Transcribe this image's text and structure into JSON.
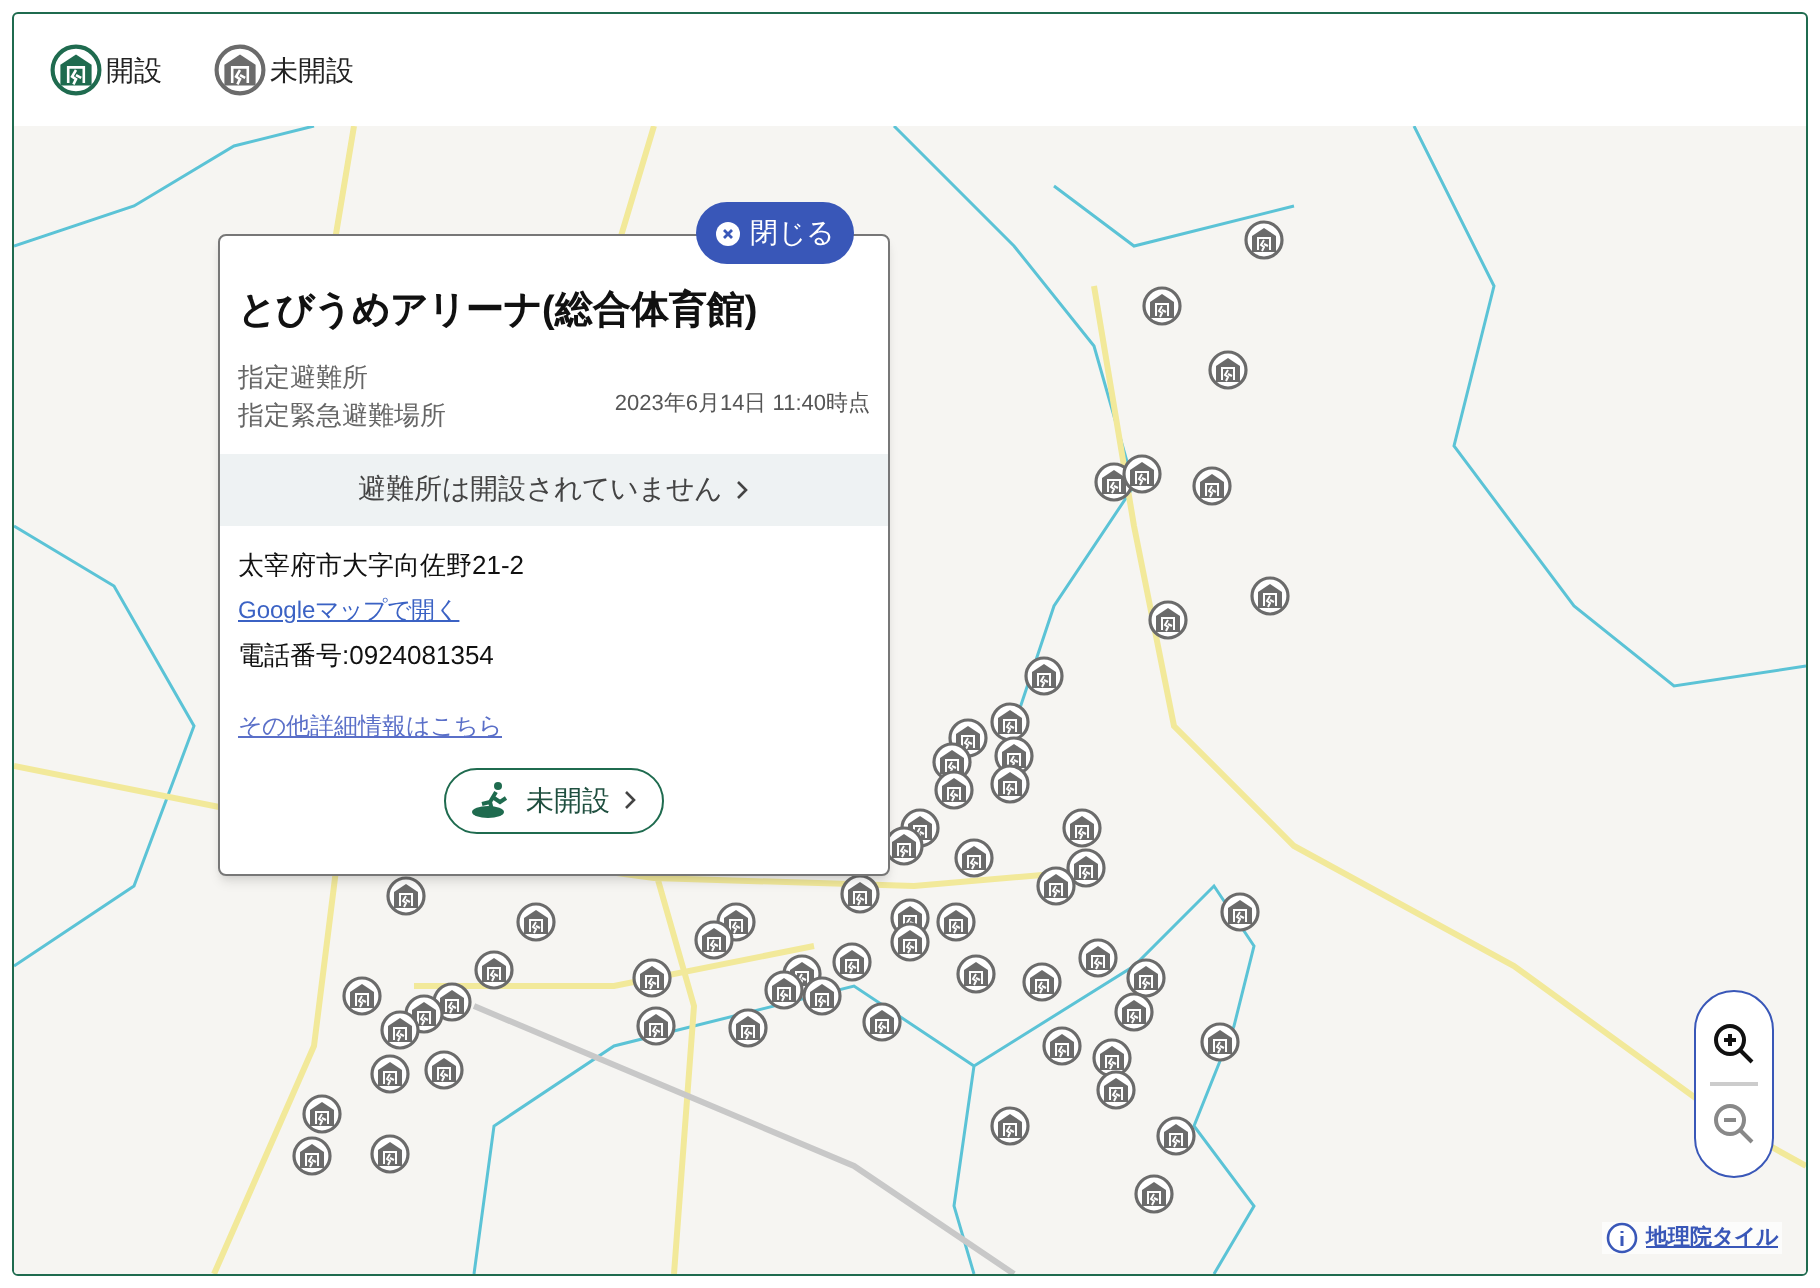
{
  "legend": [
    {
      "kind": "open",
      "label": "開設"
    },
    {
      "kind": "closed",
      "label": "未開設"
    }
  ],
  "popup": {
    "close_label": "閉じる",
    "title": "とびうめアリーナ(総合体育館)",
    "types": [
      "指定避難所",
      "指定緊急避難場所"
    ],
    "timestamp": "2023年6月14日 11:40時点",
    "status_banner": "避難所は開設されていません",
    "address": "太宰府市大字向佐野21-2",
    "map_link": "Googleマップで開く",
    "phone": "電話番号:0924081354",
    "details_link": "その他詳細情報はこちら",
    "status_button": {
      "label": "未開設",
      "opened": false
    }
  },
  "zoom_controls": [
    {
      "kind": "in",
      "disabled": false
    },
    {
      "kind": "out",
      "disabled": true
    }
  ],
  "attribution": "地理院タイル",
  "markers": [
    {
      "opened": false
    },
    {
      "opened": false
    },
    {
      "opened": false
    },
    {
      "opened": false
    },
    {
      "opened": false
    },
    {
      "opened": false
    },
    {
      "opened": false
    },
    {
      "opened": false
    },
    {
      "opened": false
    },
    {
      "opened": false
    },
    {
      "opened": false
    },
    {
      "opened": false
    },
    {
      "opened": false
    },
    {
      "opened": false
    },
    {
      "opened": false
    },
    {
      "opened": false
    },
    {
      "opened": false
    },
    {
      "opened": false
    },
    {
      "opened": false
    },
    {
      "opened": false
    },
    {
      "opened": false
    },
    {
      "opened": false
    },
    {
      "opened": false
    },
    {
      "opened": false
    },
    {
      "opened": false
    },
    {
      "opened": false
    },
    {
      "opened": false
    },
    {
      "opened": false
    },
    {
      "opened": false
    },
    {
      "opened": false
    },
    {
      "opened": false
    },
    {
      "opened": false
    },
    {
      "opened": false
    },
    {
      "opened": false
    },
    {
      "opened": false
    },
    {
      "opened": false
    },
    {
      "opened": false
    },
    {
      "opened": false
    },
    {
      "opened": false
    },
    {
      "opened": false
    },
    {
      "opened": false
    },
    {
      "opened": false
    },
    {
      "opened": false
    },
    {
      "opened": false
    },
    {
      "opened": false
    },
    {
      "opened": false
    },
    {
      "opened": false
    },
    {
      "opened": false
    },
    {
      "opened": false
    },
    {
      "opened": false
    },
    {
      "opened": false
    },
    {
      "opened": false
    },
    {
      "opened": false
    },
    {
      "opened": false
    },
    {
      "opened": false
    },
    {
      "opened": false
    },
    {
      "opened": false
    },
    {
      "opened": false
    },
    {
      "opened": false
    },
    {
      "opened": false
    }
  ]
}
